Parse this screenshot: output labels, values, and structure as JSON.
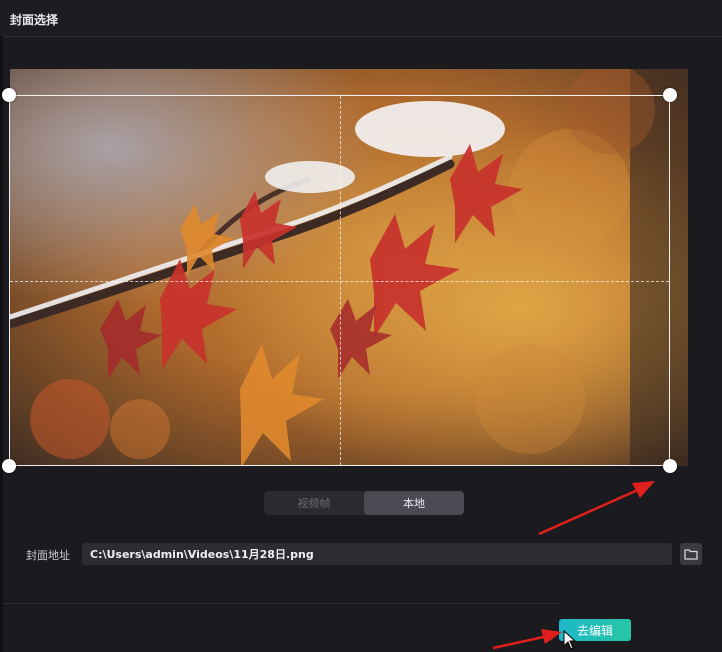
{
  "dialog": {
    "title": "封面选择"
  },
  "source_tabs": [
    {
      "label": "视频帧",
      "active": false
    },
    {
      "label": "本地",
      "active": true
    }
  ],
  "cover_path": {
    "label": "封面地址",
    "value": "C:\\Users\\admin\\Videos\\11月28日.png"
  },
  "actions": {
    "edit_label": "去编辑"
  },
  "icons": {
    "crop_handle": "circle-handle-icon",
    "browse": "folder-icon",
    "pointer": "mouse-cursor-icon"
  },
  "colors": {
    "accent_start": "#1fb7c8",
    "accent_end": "#27c7a6",
    "annotation_arrow": "#e0201c"
  }
}
